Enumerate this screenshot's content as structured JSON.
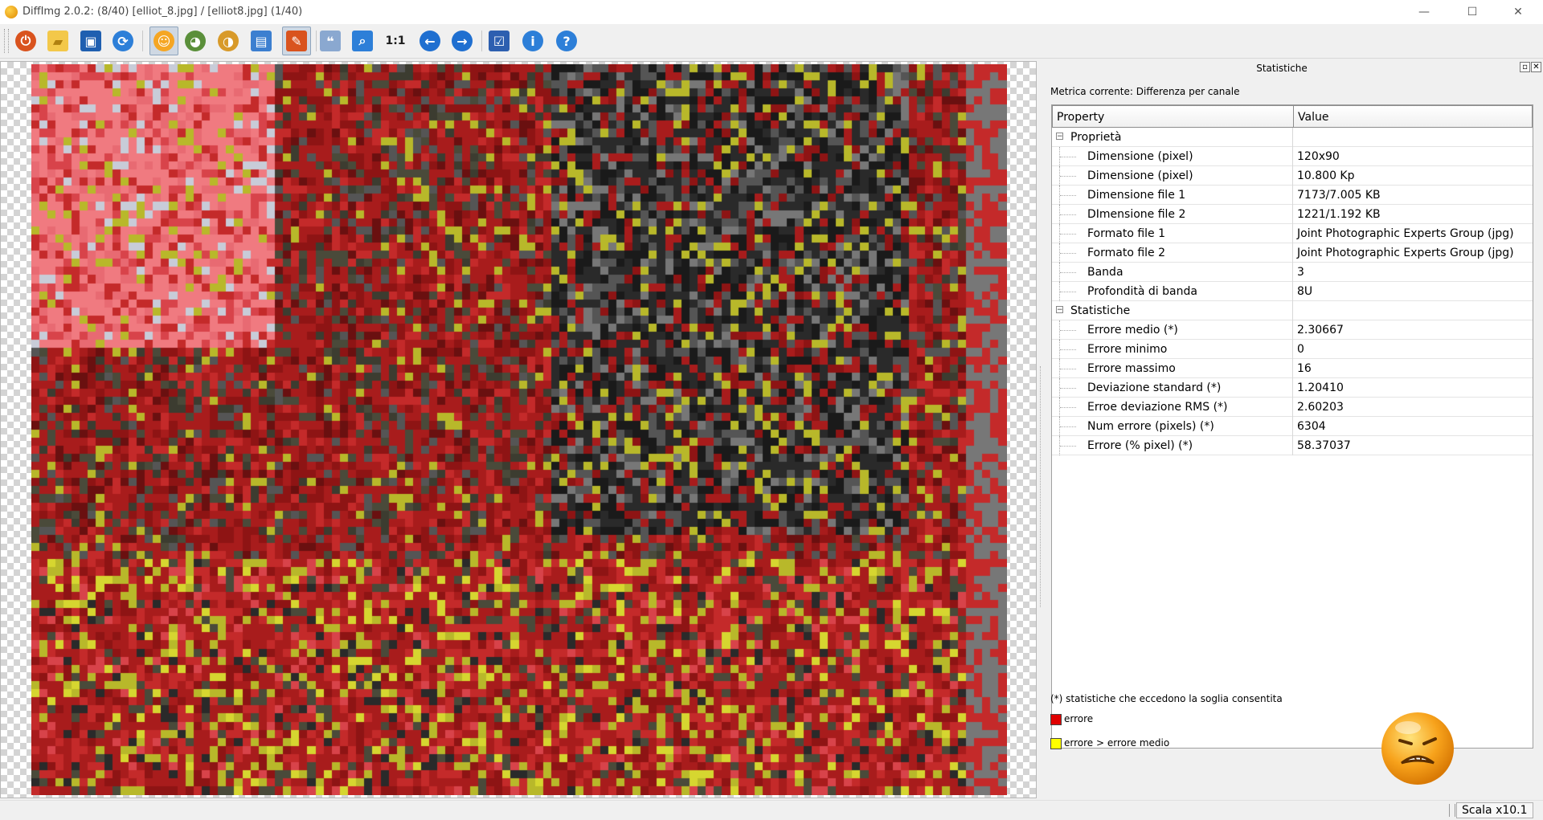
{
  "window": {
    "title": "DiffImg 2.0.2:  (8/40) [elliot_8.jpg] / [elliot8.jpg] (1/40)",
    "minimize_glyph": "—",
    "maximize_glyph": "☐",
    "close_glyph": "✕"
  },
  "toolbar": {
    "buttons": [
      {
        "name": "quit",
        "icon": "power-icon",
        "color": "#d9531e",
        "active": false
      },
      {
        "name": "open-folder",
        "icon": "folder-icon",
        "color": "#f3c84a",
        "active": false
      },
      {
        "name": "save",
        "icon": "floppy-icon",
        "color": "#1f5fb0",
        "active": false
      },
      {
        "name": "refresh",
        "icon": "refresh-icon",
        "color": "#2d7fd8",
        "active": false
      },
      {
        "name": "display-diff",
        "icon": "smiley-icon",
        "color": "#f5a623",
        "active": true
      },
      {
        "name": "display-alien",
        "icon": "alien-icon",
        "color": "#5a8f3a",
        "active": false
      },
      {
        "name": "display-mixed",
        "icon": "mixed-face-icon",
        "color": "#d89a2a",
        "active": false
      },
      {
        "name": "split-view",
        "icon": "window-icon",
        "color": "#3c7fd0",
        "active": false
      },
      {
        "name": "highlight-errors",
        "icon": "marker-icon",
        "color": "#d9531e",
        "active": true
      },
      {
        "name": "sync-views",
        "icon": "chat-icon",
        "color": "#8aa8d0",
        "active": false
      },
      {
        "name": "fit-zoom",
        "icon": "zoom-icon",
        "color": "#2d7fd8",
        "active": false
      },
      {
        "name": "original-size",
        "icon": "one-to-one-icon",
        "color": "#1e1e1e",
        "active": false
      },
      {
        "name": "previous",
        "icon": "arrow-left-icon",
        "color": "#1f6fd0",
        "active": false
      },
      {
        "name": "next",
        "icon": "arrow-right-icon",
        "color": "#1f6fd0",
        "active": false
      },
      {
        "name": "preferences",
        "icon": "checklist-icon",
        "color": "#2d5fb0",
        "active": false
      },
      {
        "name": "about",
        "icon": "info-icon",
        "color": "#2d7fd8",
        "active": false
      },
      {
        "name": "help",
        "icon": "help-icon",
        "color": "#2d7fd8",
        "active": false
      }
    ]
  },
  "stats_panel": {
    "title": "Statistiche",
    "float_glyph": "▫",
    "close_glyph": "✕",
    "metric_label": "Metrica corrente: Differenza per canale",
    "columns": [
      "Property",
      "Value"
    ],
    "groups": [
      {
        "label": "Proprietà",
        "expander": "−",
        "rows": [
          {
            "name": "Dimensione (pixel)",
            "value": "120x90"
          },
          {
            "name": "Dimensione (pixel)",
            "value": "10.800 Kp"
          },
          {
            "name": "Dimensione file 1",
            "value": "7173/7.005 KB"
          },
          {
            "name": "DImensione file 2",
            "value": "1221/1.192 KB"
          },
          {
            "name": "Formato file 1",
            "value": "Joint Photographic Experts Group (jpg)"
          },
          {
            "name": "Formato file 2",
            "value": "Joint Photographic Experts Group (jpg)"
          },
          {
            "name": "Banda",
            "value": "3"
          },
          {
            "name": "Profondità di banda",
            "value": "8U"
          }
        ]
      },
      {
        "label": "Statistiche",
        "expander": "−",
        "rows": [
          {
            "name": "Errore medio (*)",
            "value": "2.30667"
          },
          {
            "name": "Errore minimo",
            "value": "0"
          },
          {
            "name": "Errore massimo",
            "value": "16"
          },
          {
            "name": "Deviazione standard (*)",
            "value": "1.20410"
          },
          {
            "name": "Erroe deviazione RMS (*)",
            "value": "2.60203"
          },
          {
            "name": "Num errore (pixels) (*)",
            "value": "6304"
          },
          {
            "name": "Errore (% pixel) (*)",
            "value": "58.37037"
          }
        ]
      }
    ],
    "footnote": "(*) statistiche che eccedono la soglia consentita",
    "legend": [
      {
        "label": "errore",
        "color": "#e00000"
      },
      {
        "label": "errore > errore medio",
        "color": "#ffff00"
      }
    ],
    "status_face": "angry-face-icon"
  },
  "status_bar": {
    "scale": "Scala x10.1"
  },
  "diff_image": {
    "palette": [
      "#a81c1c",
      "#c42a2a",
      "#8e1414",
      "#d8434a",
      "#e86a72",
      "#f07a80",
      "#4a4a3a",
      "#3c3c30",
      "#2a2a2a",
      "#555555",
      "#777777",
      "#999999",
      "#1a1a1a",
      "#b8b82a",
      "#d6d630",
      "#c8ccd8",
      "#6a1010"
    ]
  }
}
